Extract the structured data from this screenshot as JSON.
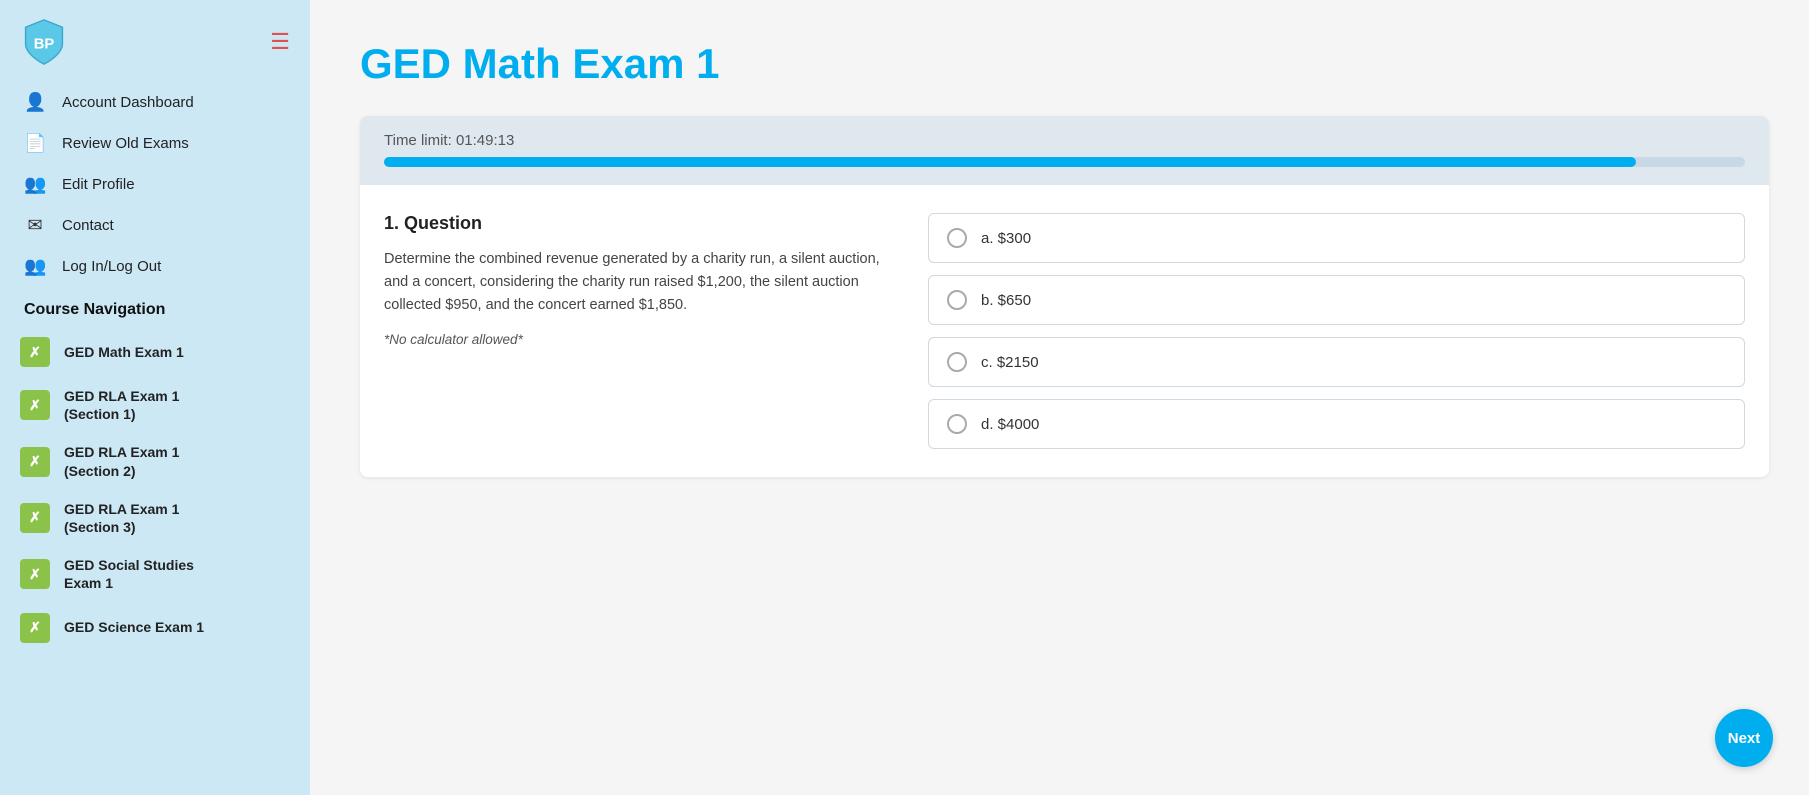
{
  "sidebar": {
    "logo_text": "BP",
    "nav_items": [
      {
        "id": "account-dashboard",
        "label": "Account Dashboard",
        "icon": "👤"
      },
      {
        "id": "review-old-exams",
        "label": "Review Old Exams",
        "icon": "📄"
      },
      {
        "id": "edit-profile",
        "label": "Edit Profile",
        "icon": "👤✏"
      },
      {
        "id": "contact",
        "label": "Contact",
        "icon": "✉"
      },
      {
        "id": "login-logout",
        "label": "Log In/Log Out",
        "icon": "👥"
      }
    ],
    "course_nav_heading": "Course Navigation",
    "course_items": [
      {
        "id": "ged-math-1",
        "label": "GED Math Exam 1",
        "icon": "✗"
      },
      {
        "id": "ged-rla-1-s1",
        "label": "GED RLA Exam 1\n(Section 1)",
        "icon": "✗"
      },
      {
        "id": "ged-rla-1-s2",
        "label": "GED RLA Exam 1\n(Section 2)",
        "icon": "✗"
      },
      {
        "id": "ged-rla-1-s3",
        "label": "GED RLA Exam 1\n(Section 3)",
        "icon": "✗"
      },
      {
        "id": "ged-social-studies",
        "label": "GED Social Studies\nExam 1",
        "icon": "✗"
      },
      {
        "id": "ged-science",
        "label": "GED Science Exam 1",
        "icon": "✗"
      }
    ]
  },
  "main": {
    "page_title": "GED Math Exam 1",
    "timer": {
      "label": "Time limit: 01:49:13",
      "progress_pct": 92
    },
    "question": {
      "heading": "1. Question",
      "body": "Determine the combined revenue generated by a charity run, a silent auction, and a concert, considering the charity run raised $1,200, the silent auction collected $950, and the concert earned $1,850.",
      "note": "*No calculator allowed*",
      "answers": [
        {
          "id": "a",
          "label": "a. $300"
        },
        {
          "id": "b",
          "label": "b. $650"
        },
        {
          "id": "c",
          "label": "c. $2150"
        },
        {
          "id": "d",
          "label": "d. $4000"
        }
      ]
    },
    "next_button_label": "Next"
  }
}
